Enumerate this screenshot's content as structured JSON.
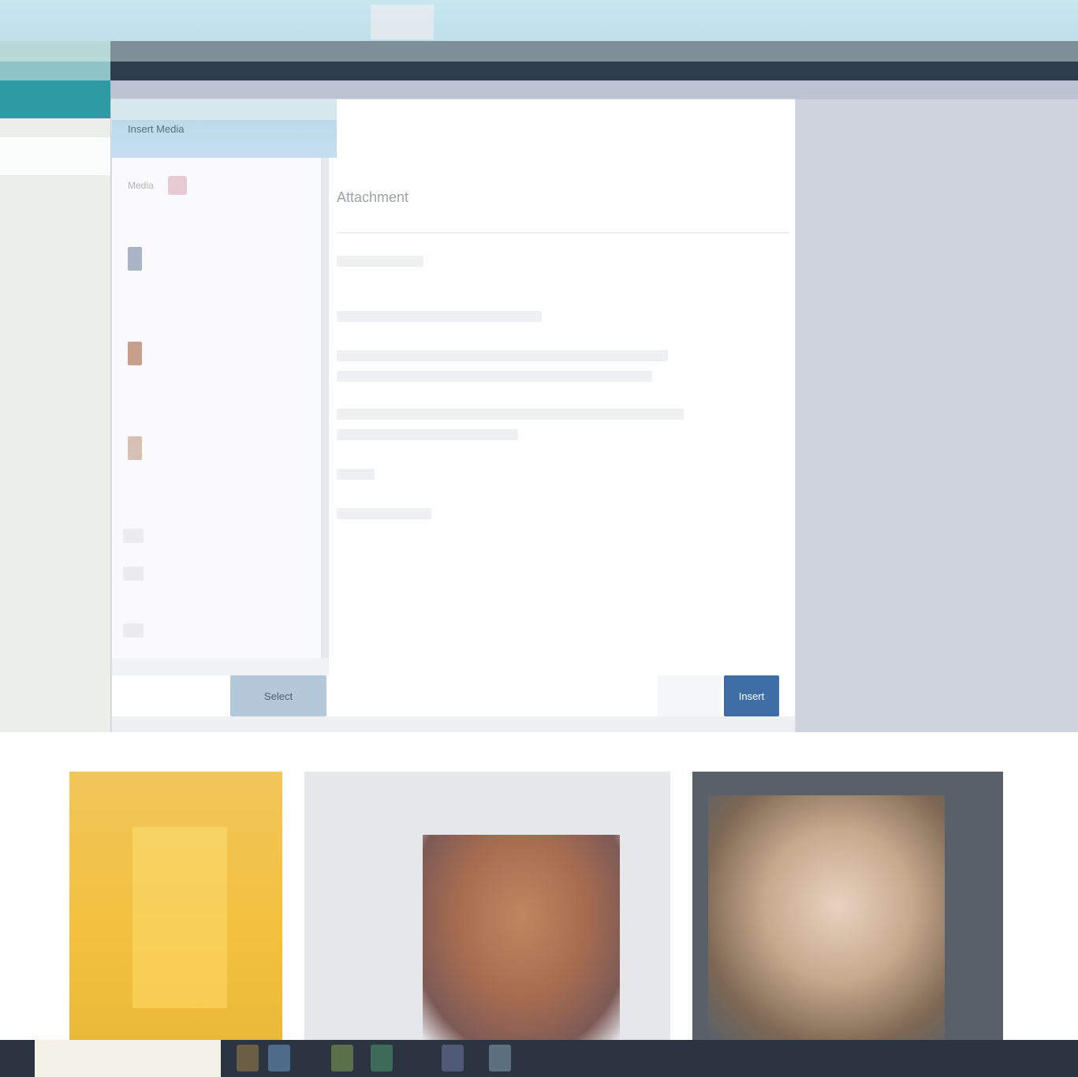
{
  "dialog": {
    "title": "Insert Media",
    "sidebar_heading": "Media",
    "media_items": [
      {
        "label": "",
        "color": "#aab4c4"
      },
      {
        "label": "",
        "color": "#c79f8a"
      },
      {
        "label": "",
        "color": "#d7c1b4"
      }
    ],
    "content_title": "Attachment",
    "content_lines": [
      "",
      "",
      "",
      "",
      "",
      "",
      "",
      ""
    ],
    "secondary_button_label": "Select",
    "cancel_label": "",
    "primary_button_label": "Insert"
  },
  "colors": {
    "accent_teal": "#2d9aa4",
    "primary_blue": "#3f6ea6",
    "navbar_dark": "#2f3e4c",
    "overlay": "#cfd3de"
  }
}
